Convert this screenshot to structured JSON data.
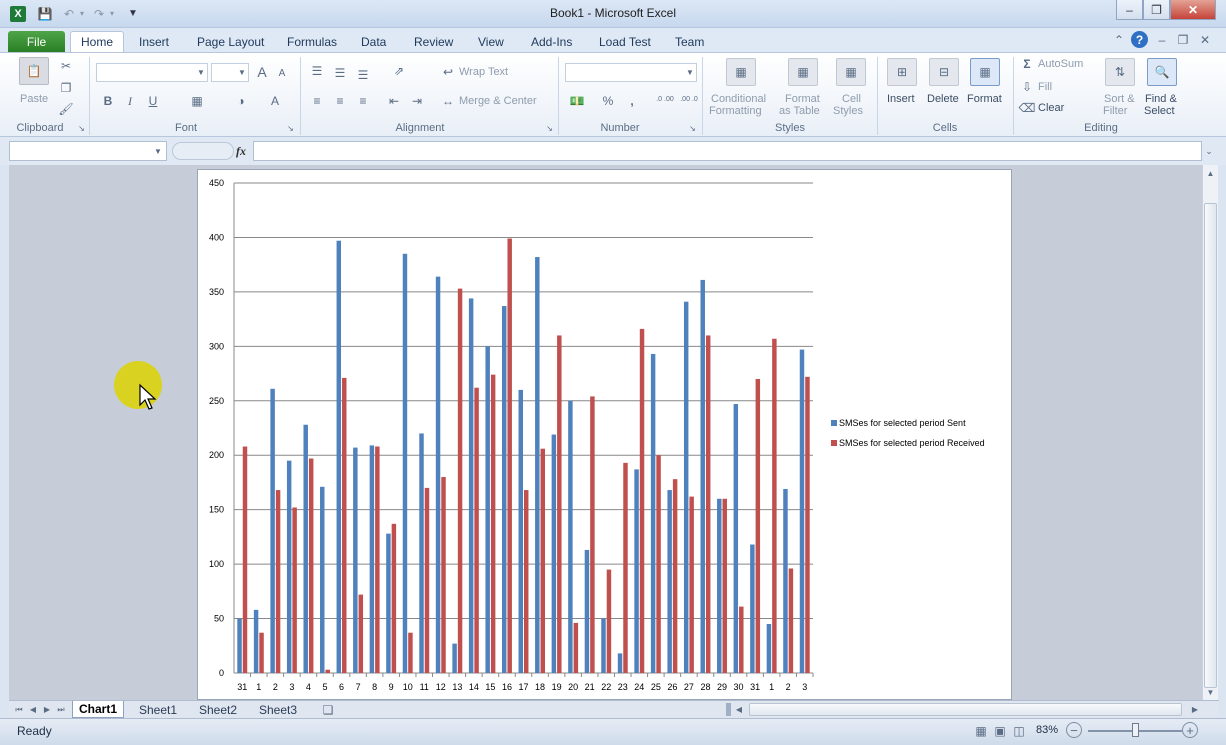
{
  "window": {
    "title": "Book1 - Microsoft Excel"
  },
  "ribbon_tabs": [
    "File",
    "Home",
    "Insert",
    "Page Layout",
    "Formulas",
    "Data",
    "Review",
    "View",
    "Add-Ins",
    "Load Test",
    "Team"
  ],
  "clipboard": {
    "paste": "Paste",
    "group": "Clipboard"
  },
  "font": {
    "group": "Font",
    "bold": "B",
    "italic": "I",
    "underline": "U",
    "grow": "A",
    "shrink": "A",
    "color": "A"
  },
  "alignment": {
    "group": "Alignment",
    "wrap_text": "Wrap Text",
    "merge_center": "Merge & Center"
  },
  "number": {
    "group": "Number",
    "percent": "%",
    "comma": ",",
    "inc_decimal": ".0 .00",
    "dec_decimal": ".00 .0"
  },
  "styles": {
    "group": "Styles",
    "conditional": "Conditional",
    "conditional2": "Formatting",
    "format_table": "Format",
    "format_table2": "as Table",
    "cell_styles": "Cell",
    "cell_styles2": "Styles"
  },
  "cells": {
    "group": "Cells",
    "insert": "Insert",
    "delete": "Delete",
    "format": "Format"
  },
  "editing": {
    "group": "Editing",
    "autosum": "AutoSum",
    "fill": "Fill",
    "clear": "Clear",
    "sort": "Sort &",
    "sort2": "Filter",
    "find": "Find &",
    "find2": "Select"
  },
  "formula_bar": {
    "fx": "fx",
    "namebox": "",
    "formula": ""
  },
  "sheets": [
    "Chart1",
    "Sheet1",
    "Sheet2",
    "Sheet3"
  ],
  "status": {
    "ready": "Ready",
    "zoom": "83%",
    "zoom_fraction": 0.5
  },
  "colors": {
    "sent": "#4f81bd",
    "received": "#c0504d",
    "accent": "#2a7f25"
  },
  "chart_data": {
    "type": "bar",
    "categories": [
      "31",
      "1",
      "2",
      "3",
      "4",
      "5",
      "6",
      "7",
      "8",
      "9",
      "10",
      "11",
      "12",
      "13",
      "14",
      "15",
      "16",
      "17",
      "18",
      "19",
      "20",
      "21",
      "22",
      "23",
      "24",
      "25",
      "26",
      "27",
      "28",
      "29",
      "30",
      "31",
      "1",
      "2",
      "3"
    ],
    "series": [
      {
        "name": "SMSes for selected period Sent",
        "values": [
          50,
          58,
          261,
          195,
          228,
          171,
          397,
          207,
          209,
          128,
          385,
          220,
          364,
          27,
          344,
          300,
          337,
          260,
          382,
          219,
          250,
          113,
          50,
          18,
          187,
          293,
          168,
          341,
          361,
          160,
          247,
          118,
          45,
          169,
          297
        ]
      },
      {
        "name": "SMSes for selected period Received",
        "values": [
          208,
          37,
          168,
          152,
          197,
          3,
          271,
          72,
          208,
          137,
          37,
          170,
          180,
          353,
          262,
          274,
          399,
          168,
          206,
          310,
          46,
          254,
          95,
          193,
          316,
          200,
          178,
          162,
          310,
          160,
          61,
          270,
          307,
          96,
          272
        ]
      }
    ],
    "yticks": [
      "0",
      "50",
      "100",
      "150",
      "200",
      "250",
      "300",
      "350",
      "400",
      "450"
    ],
    "ylim": [
      0,
      450
    ],
    "grid": true,
    "legend": "right"
  }
}
